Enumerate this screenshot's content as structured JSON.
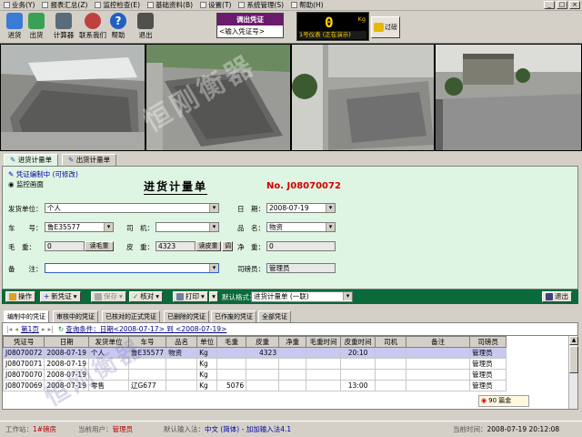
{
  "menu": [
    {
      "label": "业务(Y)"
    },
    {
      "label": "报表汇总(Z)"
    },
    {
      "label": "监控检查(E)"
    },
    {
      "label": "基础资料(B)"
    },
    {
      "label": "设置(T)"
    },
    {
      "label": "系统管理(S)"
    },
    {
      "label": "帮助(H)"
    }
  ],
  "window_controls": {
    "minimize": "_",
    "maximize": "□",
    "close": "×"
  },
  "toolbar": {
    "buttons": [
      {
        "label": "进货",
        "icon": "inbound-icon",
        "color": "#3a7bd5"
      },
      {
        "label": "出货",
        "icon": "outbound-icon",
        "color": "#3aa055"
      },
      {
        "label": "计算器",
        "icon": "calculator-icon",
        "color": "#5a6b7a"
      },
      {
        "label": "联系我们",
        "icon": "contact-icon",
        "color": "#c04040"
      },
      {
        "label": "帮助",
        "icon": "help-icon",
        "color": "#2060c0"
      },
      {
        "label": "退出",
        "icon": "exit-icon",
        "color": "#505050"
      }
    ],
    "voucher_call": {
      "title": "调出凭证",
      "placeholder": "<输入凭证号>"
    },
    "weight": {
      "value": "0",
      "unit": "Kg",
      "status": "1号仪表 (正在演示)"
    },
    "overweight_label": "过磅"
  },
  "tabs": [
    {
      "label": "进货计量单",
      "active": true
    },
    {
      "label": "出货计量单",
      "active": false
    }
  ],
  "form": {
    "edit_status": "凭证编制中 (可修改)",
    "monitor_label": "监控画面",
    "title": "进货计量单",
    "number": "No. J08070072",
    "fields": {
      "sender_label": "发货单位：",
      "sender": "个人",
      "date_label": "日　期：",
      "date": "2008-07-19",
      "plate_label": "车　　号：",
      "plate": "鲁E35577",
      "driver_label": "司　机：",
      "driver": "",
      "goods_label": "品　名：",
      "goods": "物资",
      "gross_label": "毛　重：",
      "gross": "0",
      "read_gross": "读毛重",
      "tare_label": "皮　重：",
      "tare": "4323",
      "read_tare": "读皮重",
      "adjust": "调",
      "net_label": "净　重：",
      "net": "0",
      "remark_label": "备　　注：",
      "remark": "",
      "weigher_label": "司磅员：",
      "weigher": "管理员"
    }
  },
  "actions": {
    "operate": "操作",
    "new_voucher": "新凭证",
    "save": "保存",
    "audit": "核对",
    "print": "打印",
    "default_format_label": "默认格式：",
    "default_format": "进货计量单 (一联)",
    "exit": "退出"
  },
  "list_tabs": [
    {
      "label": "编制中的凭证",
      "active": true
    },
    {
      "label": "审核中的凭证"
    },
    {
      "label": "已核对的正式凭证"
    },
    {
      "label": "已删除的凭证"
    },
    {
      "label": "已作废的凭证"
    },
    {
      "label": "全部凭证"
    }
  ],
  "pager": {
    "page": "第1页",
    "query_label": "查询条件：日期",
    "date_from": "<2008-07-17>",
    "to": "到",
    "date_to": "<2008-07-19>"
  },
  "grid": {
    "columns": [
      "凭证号",
      "日期",
      "发货单位",
      "车号",
      "品名",
      "单位",
      "毛重",
      "皮重",
      "净重",
      "毛重时间",
      "皮重时间",
      "司机",
      "备注",
      "司磅员"
    ],
    "rows": [
      {
        "values": [
          "J08070072",
          "2008-07-19",
          "个人",
          "鲁E35577",
          "物资",
          "Kg",
          "",
          "4323",
          "",
          "",
          "20:10",
          "",
          "",
          "管理员"
        ],
        "selected": true
      },
      {
        "values": [
          "J08070071",
          "2008-07-19",
          "",
          "",
          "",
          "Kg",
          "",
          "",
          "",
          "",
          "",
          "",
          "",
          "管理员"
        ],
        "selected": false
      },
      {
        "values": [
          "J08070070",
          "2008-07-19",
          "",
          "",
          "",
          "Kg",
          "",
          "",
          "",
          "",
          "",
          "",
          "",
          "管理员"
        ],
        "selected": false
      },
      {
        "values": [
          "J08070069",
          "2008-07-19",
          "零售",
          "辽G677",
          "",
          "Kg",
          "5076",
          "",
          "",
          "",
          "13:00",
          "",
          "",
          "管理员"
        ],
        "selected": false
      }
    ]
  },
  "ime_badge": "90 篇金",
  "status": {
    "station_label": "工作站：",
    "station": "1#磅房",
    "user_label": "当前用户：",
    "user": "管理员",
    "ime_label": "默认输入法：",
    "ime": "中文 (简体) - 加加输入法4.1",
    "time_label": "当前时间：",
    "time": "2008-07-19 20:12:08"
  },
  "watermark": "恒刚衡器"
}
